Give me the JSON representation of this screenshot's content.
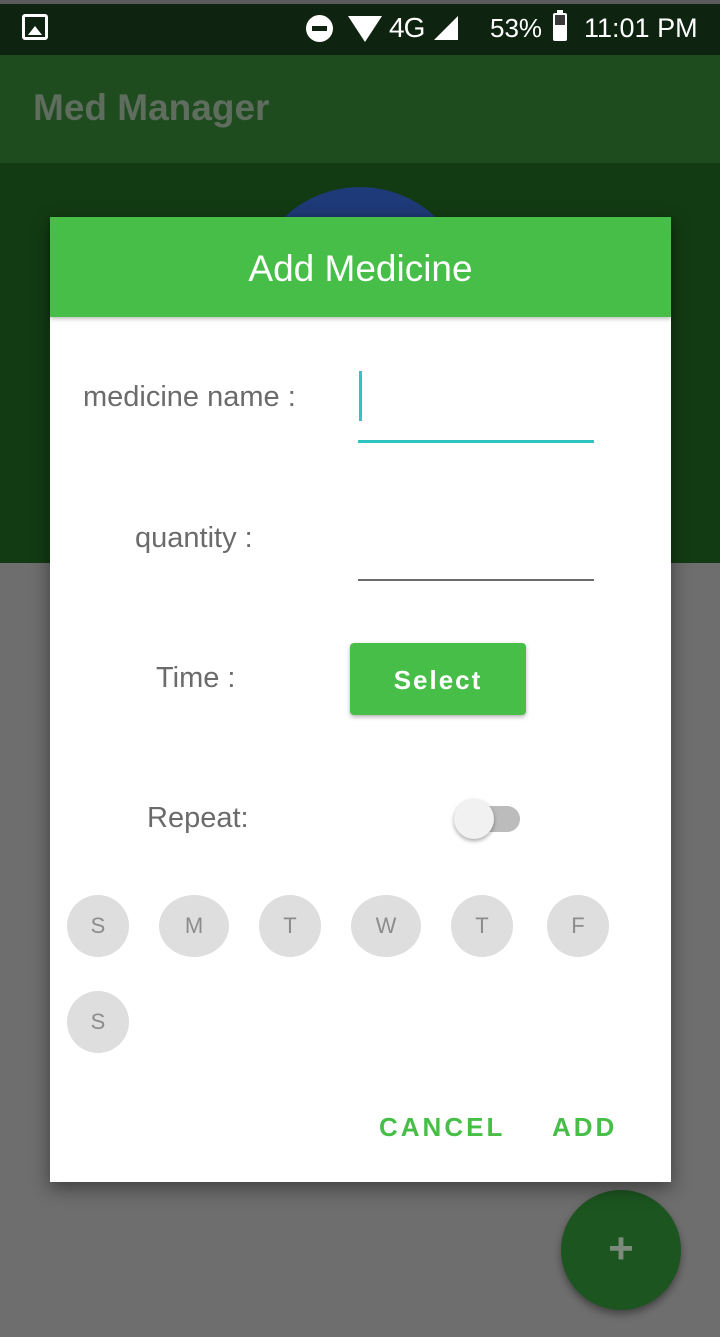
{
  "status_bar": {
    "network": "4G",
    "battery": "53%",
    "time": "11:01 PM",
    "icons": [
      "image-icon",
      "do-not-disturb-icon",
      "wifi-icon",
      "cell-signal-icon",
      "battery-icon"
    ]
  },
  "app": {
    "title": "Med Manager",
    "fab_label": "+"
  },
  "dialog": {
    "title": "Add Medicine",
    "fields": {
      "medicine_name_label": "medicine name :",
      "medicine_name_value": "",
      "quantity_label": "quantity :",
      "quantity_value": "",
      "time_label": "Time :",
      "select_button": "Select",
      "repeat_label": "Repeat:",
      "repeat_on": false
    },
    "days": [
      "S",
      "M",
      "T",
      "W",
      "T",
      "F",
      "S"
    ],
    "actions": {
      "cancel": "CANCEL",
      "add": "ADD"
    }
  },
  "colors": {
    "accent": "#46be48",
    "input_focus": "#2ec4c0",
    "appbar": "#1f4c1f"
  }
}
